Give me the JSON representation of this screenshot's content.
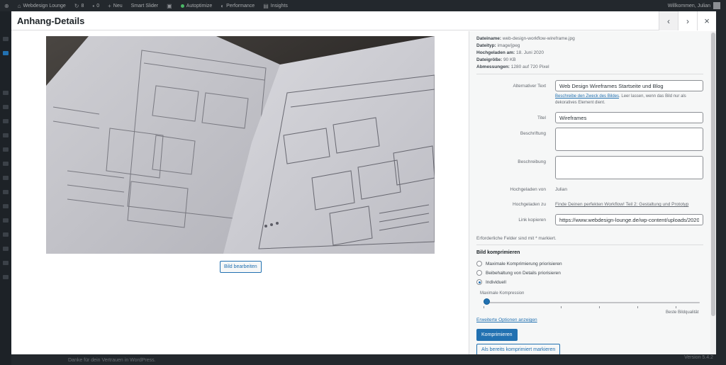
{
  "adminbar": {
    "site_name": "Webdesign Lounge",
    "updates": "8",
    "comments": "0",
    "new_label": "Neu",
    "smart_slider": "Smart Slider",
    "autoptimize": "Autoptimize",
    "performance": "Performance",
    "insights": "Insights",
    "greeting": "Willkommen, Julian"
  },
  "footer": {
    "thanks": "Danke für dein Vertrauen in WordPress.",
    "version": "Version 5.4.2"
  },
  "modal": {
    "title": "Anhang-Details",
    "prev_icon": "chevron-left-icon",
    "next_icon": "chevron-right-icon",
    "close_icon": "close-icon",
    "edit_image_label": "Bild bearbeiten"
  },
  "fileinfo": {
    "filename_label": "Dateiname:",
    "filename": "web-design-workflow-wireframe.jpg",
    "filetype_label": "Dateityp:",
    "filetype": "image/jpeg",
    "uploaded_label": "Hochgeladen am:",
    "uploaded": "18. Juni 2020",
    "filesize_label": "Dateigröße:",
    "filesize": "90 KB",
    "dimensions_label": "Abmessungen:",
    "dimensions": "1280 auf 720 Pixel"
  },
  "fields": {
    "alt_label": "Alternativer Text",
    "alt_value": "Web Design Wireframes Startseite und Blog",
    "alt_help_link": "Beschreibe den Zweck des Bildes",
    "alt_help_text": ". Leer lassen, wenn das Bild nur als dekoratives Element dient.",
    "title_label": "Titel",
    "title_value": "Wireframes",
    "caption_label": "Beschriftung",
    "caption_value": "",
    "description_label": "Beschreibung",
    "description_value": "",
    "uploaded_by_label": "Hochgeladen von",
    "uploaded_by": "Julian",
    "uploaded_to_label": "Hochgeladen zu",
    "uploaded_to": "Finde Deinen perfekten Workflow! Teil 2: Gestaltung und Prototyp",
    "copy_link_label": "Link kopieren",
    "copy_link_value": "https://www.webdesign-lounge.de/wp-content/uploads/2020",
    "required_note": "Erforderliche Felder sind mit * markiert."
  },
  "compress": {
    "title": "Bild komprimieren",
    "options": [
      {
        "label": "Maximale Komprimierung priorisieren",
        "checked": false
      },
      {
        "label": "Beibehaltung von Details priorisieren",
        "checked": false
      },
      {
        "label": "Individuell",
        "checked": true
      }
    ],
    "slider_label": "Maximale Kompression",
    "slider_end_label": "Beste Bildqualität",
    "slider_value": 0,
    "advanced_link": "Erweiterte Optionen anzeigen",
    "compress_button": "Komprimieren",
    "mark_button": "Als bereits komprimiert markieren"
  },
  "colors": {
    "accent": "#2271b1",
    "adminbar": "#23282d",
    "panel": "#f6f7f7"
  }
}
